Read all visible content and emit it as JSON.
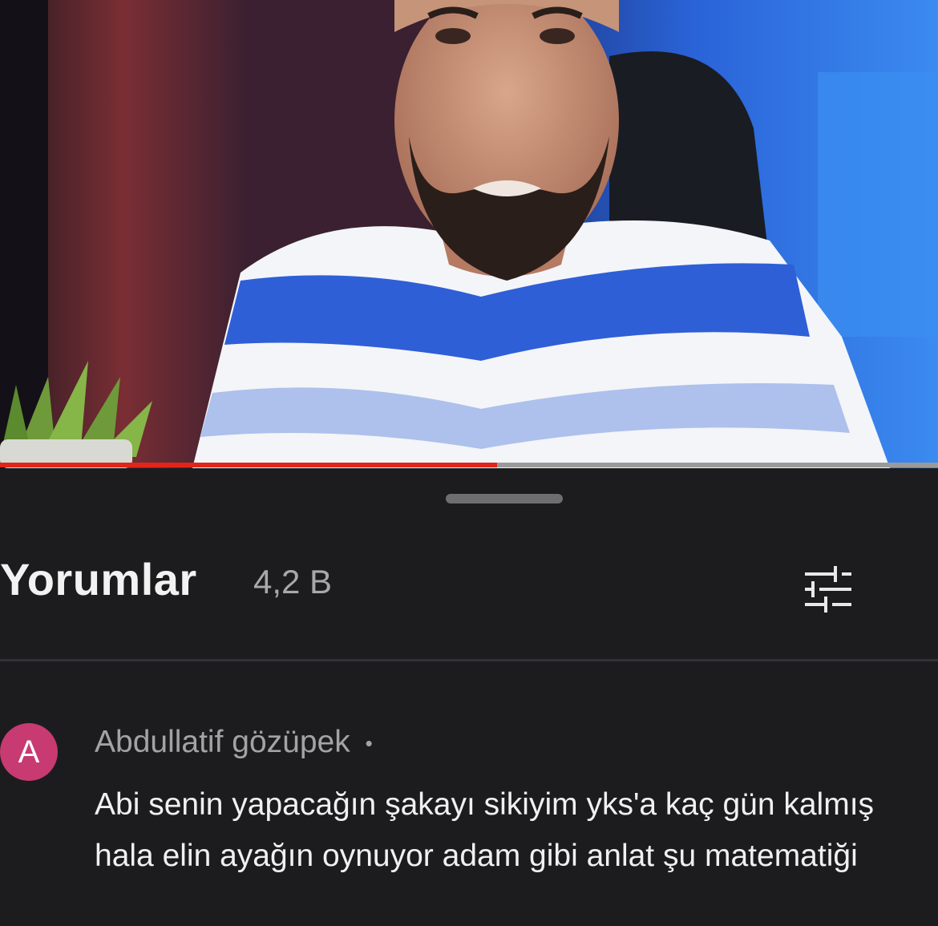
{
  "video": {
    "progress": 0.53,
    "colors": {
      "progress_played": "#e1251b",
      "progress_remaining": "#9a9a9a"
    }
  },
  "comments_panel": {
    "title": "Yorumlar",
    "count": "4,2 B",
    "filter_icon": "sliders-icon"
  },
  "comments": [
    {
      "avatar_letter": "A",
      "avatar_color": "#c83a72",
      "author": "Abdullatif gözüpek",
      "separator": "•",
      "text": "Abi senin yapacağın şakayı sikiyim yks'a kaç gün kalmış hala elin ayağın oynuyor adam gibi anlat şu matematiği"
    }
  ]
}
